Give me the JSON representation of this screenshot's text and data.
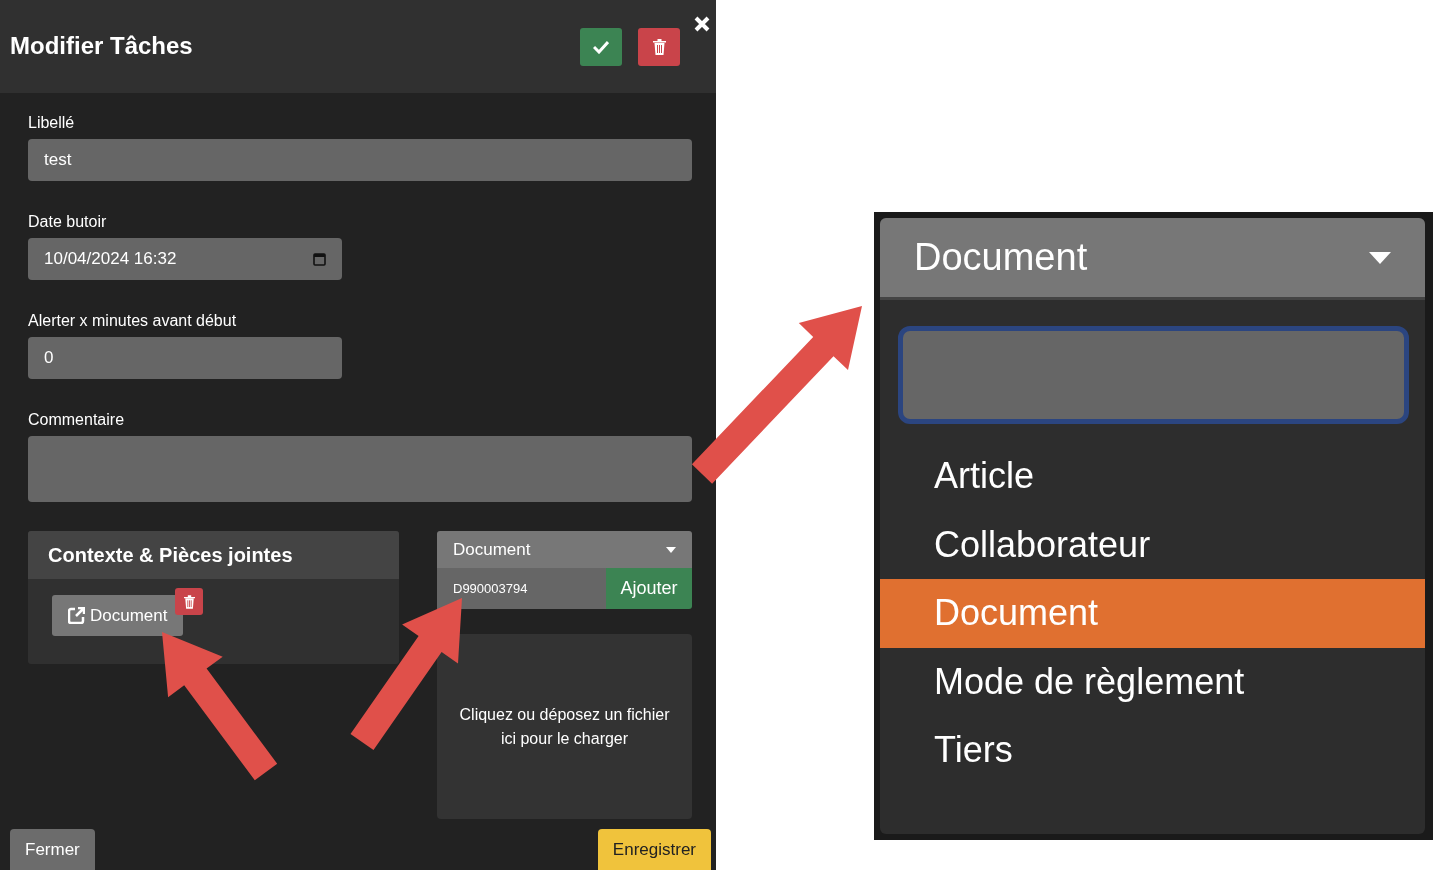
{
  "dialog": {
    "title": "Modifier Tâches"
  },
  "fields": [
    {
      "kind": "text",
      "label": "Libellé",
      "value": "test"
    },
    {
      "kind": "datetime",
      "label": "Date butoir",
      "value": "10/04/2024  16:32"
    },
    {
      "kind": "number",
      "label": "Alerter x minutes avant début",
      "value": "0"
    },
    {
      "kind": "textarea",
      "label": "Commentaire"
    }
  ],
  "context_panel": {
    "title": "Contexte & Pièces jointes",
    "attachments": [
      {
        "label": "Document"
      }
    ]
  },
  "link_form": {
    "type_select": "Document",
    "reference": "D990003794",
    "add_button": "Ajouter"
  },
  "dropzone": {
    "text": "Cliquez ou déposez un fichier ici pour le charger"
  },
  "footer": {
    "close_button": "Fermer",
    "save_button": "Enregistrer"
  },
  "dropdown_zoom": {
    "select_value": "Document",
    "options": [
      {
        "label": "Article",
        "selected": false
      },
      {
        "label": "Collaborateur",
        "selected": false
      },
      {
        "label": "Document",
        "selected": true
      },
      {
        "label": "Mode de règlement",
        "selected": false
      },
      {
        "label": "Tiers",
        "selected": false
      }
    ]
  }
}
